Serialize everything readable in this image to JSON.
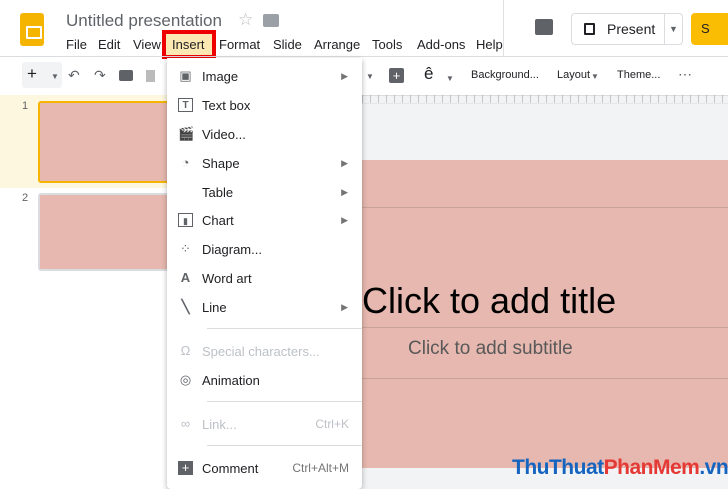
{
  "app": {
    "title": "Untitled presentation"
  },
  "menubar": [
    "File",
    "Edit",
    "View",
    "Insert",
    "Format",
    "Slide",
    "Arrange",
    "Tools",
    "Add-ons",
    "Help"
  ],
  "header": {
    "present_label": "Present",
    "share_label": "S"
  },
  "toolbar": {
    "background": "Background...",
    "layout": "Layout",
    "theme": "Theme...",
    "more": "⋯"
  },
  "filmstrip": {
    "slides": [
      "1",
      "2"
    ]
  },
  "slide": {
    "title_placeholder": "Click to add title",
    "subtitle_placeholder": "Click to add subtitle"
  },
  "insert_menu": {
    "items": [
      {
        "label": "Image",
        "icon": "image-icon",
        "submenu": true
      },
      {
        "label": "Text box",
        "icon": "text-box-icon"
      },
      {
        "label": "Video...",
        "icon": "video-icon"
      },
      {
        "label": "Shape",
        "icon": "shape-icon",
        "submenu": true
      },
      {
        "label": "Table",
        "submenu": true
      },
      {
        "label": "Chart",
        "icon": "chart-icon",
        "submenu": true
      },
      {
        "label": "Diagram...",
        "icon": "diagram-icon"
      },
      {
        "label": "Word art",
        "icon": "word-art-icon"
      },
      {
        "label": "Line",
        "icon": "line-icon",
        "submenu": true
      },
      {
        "label": "Special characters...",
        "icon": "omega-icon",
        "disabled": true
      },
      {
        "label": "Animation",
        "icon": "animation-icon"
      },
      {
        "label": "Link...",
        "icon": "link-icon",
        "shortcut": "Ctrl+K",
        "disabled": true
      },
      {
        "label": "Comment",
        "icon": "comment-icon",
        "shortcut": "Ctrl+Alt+M"
      }
    ]
  },
  "watermark": {
    "part1": "ThuThuat",
    "part2": "PhanMem",
    "part3": ".vn"
  },
  "colors": {
    "accent": "#f4b400",
    "slide_bg": "#e6b8af",
    "highlight": "#ff0000"
  }
}
